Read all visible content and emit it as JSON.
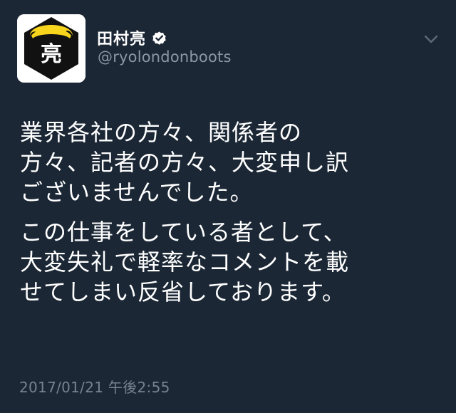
{
  "user": {
    "display_name": "田村亮",
    "handle": "@ryolondonboots",
    "avatar_character": "亮",
    "verified": true
  },
  "tweet": {
    "paragraphs": [
      {
        "lines": [
          "業界各社の方々、関係者の",
          "方々、記者の方々、大変申し訳",
          "ございませんでした。"
        ]
      },
      {
        "lines": [
          "この仕事をしている者として、",
          "大変失礼で軽率なコメントを載",
          "せてしまい反省しております。"
        ]
      }
    ],
    "timestamp": "2017/01/21 午後2:55"
  },
  "icons": {
    "verified": "verified-badge-icon",
    "menu": "chevron-down-icon"
  },
  "colors": {
    "background": "#1b2735",
    "text": "#ffffff",
    "secondary_text": "#8b98a5",
    "avatar_hair": "#f7d51d"
  }
}
